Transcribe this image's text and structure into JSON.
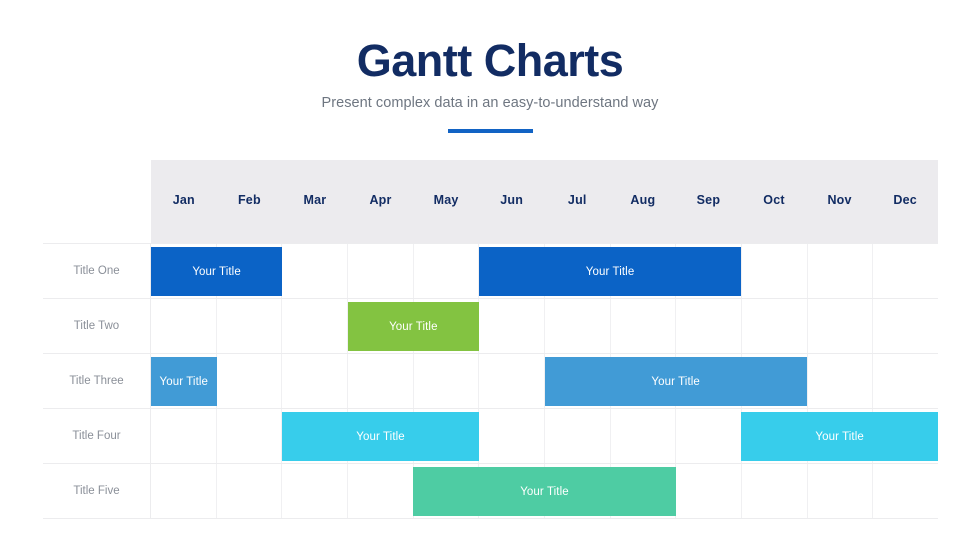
{
  "header": {
    "title": "Gantt Charts",
    "subtitle": "Present complex data in an easy-to-understand way",
    "rule_color": "#1263C4",
    "title_color": "#122C63",
    "subtitle_color": "#6E7681"
  },
  "chart_data": {
    "type": "bar",
    "title": "Gantt Charts",
    "subtitle": "Present complex data in an easy-to-understand way",
    "xlabel": "",
    "ylabel": "",
    "grid": true,
    "legend": "none",
    "categories": [
      "Jan",
      "Feb",
      "Mar",
      "Apr",
      "May",
      "Jun",
      "Jul",
      "Aug",
      "Sep",
      "Oct",
      "Nov",
      "Dec"
    ],
    "rows": [
      "Title One",
      "Title Two",
      "Title Three",
      "Title Four",
      "Title Five"
    ],
    "tasks": [
      {
        "row": "Title One",
        "label": "Your Title",
        "start_month": "Jan",
        "end_month": "Feb",
        "start_index": 0,
        "span": 2,
        "color": "#0B63C6"
      },
      {
        "row": "Title One",
        "label": "Your Title",
        "start_month": "Jun",
        "end_month": "Sep",
        "start_index": 5,
        "span": 4,
        "color": "#0B63C6"
      },
      {
        "row": "Title Two",
        "label": "Your Title",
        "start_month": "Apr",
        "end_month": "May",
        "start_index": 3,
        "span": 2,
        "color": "#83C341"
      },
      {
        "row": "Title Three",
        "label": "Your Title",
        "start_month": "Jan",
        "end_month": "Jan",
        "start_index": 0,
        "span": 1,
        "color": "#419BD6"
      },
      {
        "row": "Title Three",
        "label": "Your Title",
        "start_month": "Jul",
        "end_month": "Oct",
        "start_index": 6,
        "span": 4,
        "color": "#419BD6"
      },
      {
        "row": "Title Four",
        "label": "Your Title",
        "start_month": "Mar",
        "end_month": "May",
        "start_index": 2,
        "span": 3,
        "color": "#37CDEB"
      },
      {
        "row": "Title Four",
        "label": "Your Title",
        "start_month": "Oct",
        "end_month": "Dec",
        "start_index": 9,
        "span": 3,
        "color": "#37CDEB"
      },
      {
        "row": "Title Five",
        "label": "Your Title",
        "start_month": "May",
        "end_month": "Aug",
        "start_index": 4,
        "span": 4,
        "color": "#4ECCA3"
      }
    ],
    "palette": {
      "dark_blue": "#0B63C6",
      "green": "#83C341",
      "medium_blue": "#419BD6",
      "cyan": "#37CDEB",
      "teal": "#4ECCA3",
      "header_band": "#ECEBEE",
      "grid_line": "#ECECEE"
    }
  }
}
